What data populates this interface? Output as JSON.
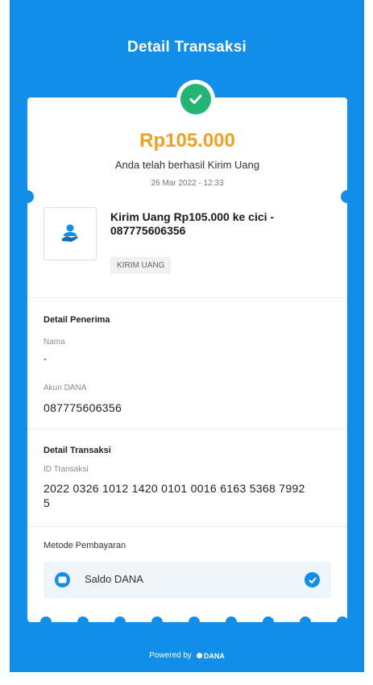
{
  "header": {
    "title": "Detail Transaksi"
  },
  "summary": {
    "amount": "Rp105.000",
    "message": "Anda telah berhasil Kirim Uang",
    "datetime": "26 Mar 2022 - 12:33"
  },
  "product": {
    "icon": "send-money-icon",
    "title": "Kirim Uang Rp105.000 ke cici - 087775606356",
    "type": "KIRIM UANG"
  },
  "recipient": {
    "section_title": "Detail Penerima",
    "name_label": "Nama",
    "name_value": "-",
    "account_label": "Akun DANA",
    "account_value": "087775606356"
  },
  "transaction": {
    "section_title": "Detail Transaksi",
    "id_label": "ID Transaksi",
    "id_value": "2022 0326 1012 1420 0101 0016 6163 5368 7992 5"
  },
  "payment": {
    "label": "Metode Pembayaran",
    "method": "Saldo DANA",
    "icon": "wallet-icon"
  },
  "footer": {
    "powered_by": "Powered by",
    "brand": "DANA"
  },
  "colors": {
    "brand_blue": "#118ee9",
    "amount_orange": "#f2a021",
    "success_green": "#22b573"
  }
}
